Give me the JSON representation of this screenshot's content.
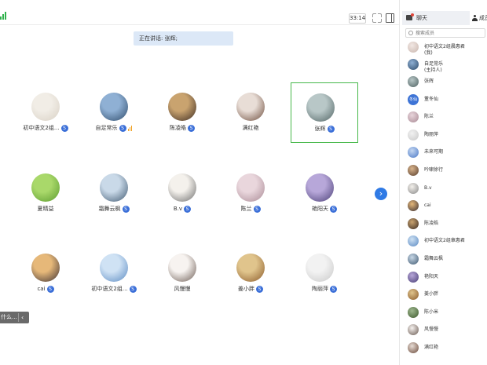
{
  "topbar": {
    "timer": "33:14"
  },
  "banner": {
    "speaking_text": "正在讲话: 张辉;"
  },
  "grid": {
    "tiles": [
      {
        "name": "初中语文2组...",
        "badge": "S",
        "colors": [
          "#f1ede6",
          "#d8d0c4"
        ]
      },
      {
        "name": "自足常乐",
        "badge": "S",
        "colors": [
          "#8fb0d4",
          "#2e4b6a"
        ],
        "mic": true
      },
      {
        "name": "陈凌皓",
        "badge": "S",
        "colors": [
          "#c9a36f",
          "#3a2a22"
        ]
      },
      {
        "name": "满红艳",
        "badge": "",
        "colors": [
          "#e8ddd6",
          "#6b4a3a"
        ]
      },
      {
        "name": "张辉",
        "badge": "S",
        "colors": [
          "#b8c7c7",
          "#4f6262"
        ],
        "selected": true
      },
      {
        "name": "夏晴益",
        "badge": "",
        "colors": [
          "#a9d86a",
          "#5a9a2e"
        ]
      },
      {
        "name": "霜舞云枫",
        "badge": "S",
        "colors": [
          "#c9d9e8",
          "#3f5870"
        ]
      },
      {
        "name": "B.v",
        "badge": "S",
        "colors": [
          "#f4f1ec",
          "#6b6b6b"
        ]
      },
      {
        "name": "陈兰",
        "badge": "S",
        "colors": [
          "#e9d6dc",
          "#a98a95"
        ]
      },
      {
        "name": "艳阳天",
        "badge": "S",
        "colors": [
          "#b7a7d9",
          "#4a3f76"
        ]
      },
      {
        "name": "cai",
        "badge": "S",
        "colors": [
          "#e6b879",
          "#3a2f33"
        ]
      },
      {
        "name": "初中语文2组...",
        "badge": "S",
        "colors": [
          "#cfe2f4",
          "#5b8ac2"
        ]
      },
      {
        "name": "风慢慢",
        "badge": "",
        "colors": [
          "#f7f3f0",
          "#6a5a52"
        ]
      },
      {
        "name": "姜小胖",
        "badge": "S",
        "colors": [
          "#e0c48c",
          "#8a5a2a"
        ]
      },
      {
        "name": "陶丽萍",
        "badge": "S",
        "colors": [
          "#f2f2f2",
          "#c8c8c8"
        ]
      }
    ]
  },
  "left_tab": {
    "label": "什么..."
  },
  "sidebar": {
    "chat_tab": "聊天",
    "members_tab": "成员",
    "search_placeholder": "搜索成员",
    "members": [
      {
        "name": "初中语文2组晨惠君",
        "sub": "(我)",
        "colors": [
          "#f2e8e4",
          "#c9b6ae"
        ]
      },
      {
        "name": "自足常乐",
        "sub": "(主持人)",
        "colors": [
          "#8fb0d4",
          "#2e4b6a"
        ]
      },
      {
        "name": "张辉",
        "sub": "",
        "colors": [
          "#b8c7c7",
          "#4f6262"
        ]
      },
      {
        "name": "董冬仙",
        "sub": "",
        "initials": "冬仙"
      },
      {
        "name": "陈兰",
        "sub": "",
        "colors": [
          "#e9d6dc",
          "#a98a95"
        ]
      },
      {
        "name": "陶丽萍",
        "sub": "",
        "colors": [
          "#f2f2f2",
          "#c8c8c8"
        ]
      },
      {
        "name": "未来可期",
        "sub": "",
        "colors": [
          "#c6d8f2",
          "#4a78c6"
        ]
      },
      {
        "name": "吟啸徐行",
        "sub": "",
        "colors": [
          "#d9b48c",
          "#5a3f2e"
        ]
      },
      {
        "name": "B.v",
        "sub": "",
        "colors": [
          "#f4f1ec",
          "#8a8a8a"
        ]
      },
      {
        "name": "cai",
        "sub": "",
        "colors": [
          "#e6b879",
          "#3a2f33"
        ]
      },
      {
        "name": "陈凌皓",
        "sub": "",
        "colors": [
          "#c9a36f",
          "#3a2a22"
        ]
      },
      {
        "name": "初中语文2组章惠君",
        "sub": "",
        "colors": [
          "#cfe2f4",
          "#5b8ac2"
        ]
      },
      {
        "name": "霜舞云枫",
        "sub": "",
        "colors": [
          "#c9d9e8",
          "#3f5870"
        ]
      },
      {
        "name": "艳阳天",
        "sub": "",
        "colors": [
          "#b7a7d9",
          "#4a3f76"
        ]
      },
      {
        "name": "姜小胖",
        "sub": "",
        "colors": [
          "#e0c48c",
          "#8a5a2a"
        ]
      },
      {
        "name": "陈小米",
        "sub": "",
        "colors": [
          "#9fb88f",
          "#3e5a2e"
        ]
      },
      {
        "name": "风慢慢",
        "sub": "",
        "colors": [
          "#f7f3f0",
          "#6a5a52"
        ]
      },
      {
        "name": "满红艳",
        "sub": "",
        "colors": [
          "#e8ddd6",
          "#6b4a3a"
        ]
      }
    ]
  },
  "colors": {
    "accent": "#2f7ae5",
    "badge": "#3b6fd8",
    "selected_border": "#46b84a",
    "banner_bg": "#dce8f7"
  }
}
